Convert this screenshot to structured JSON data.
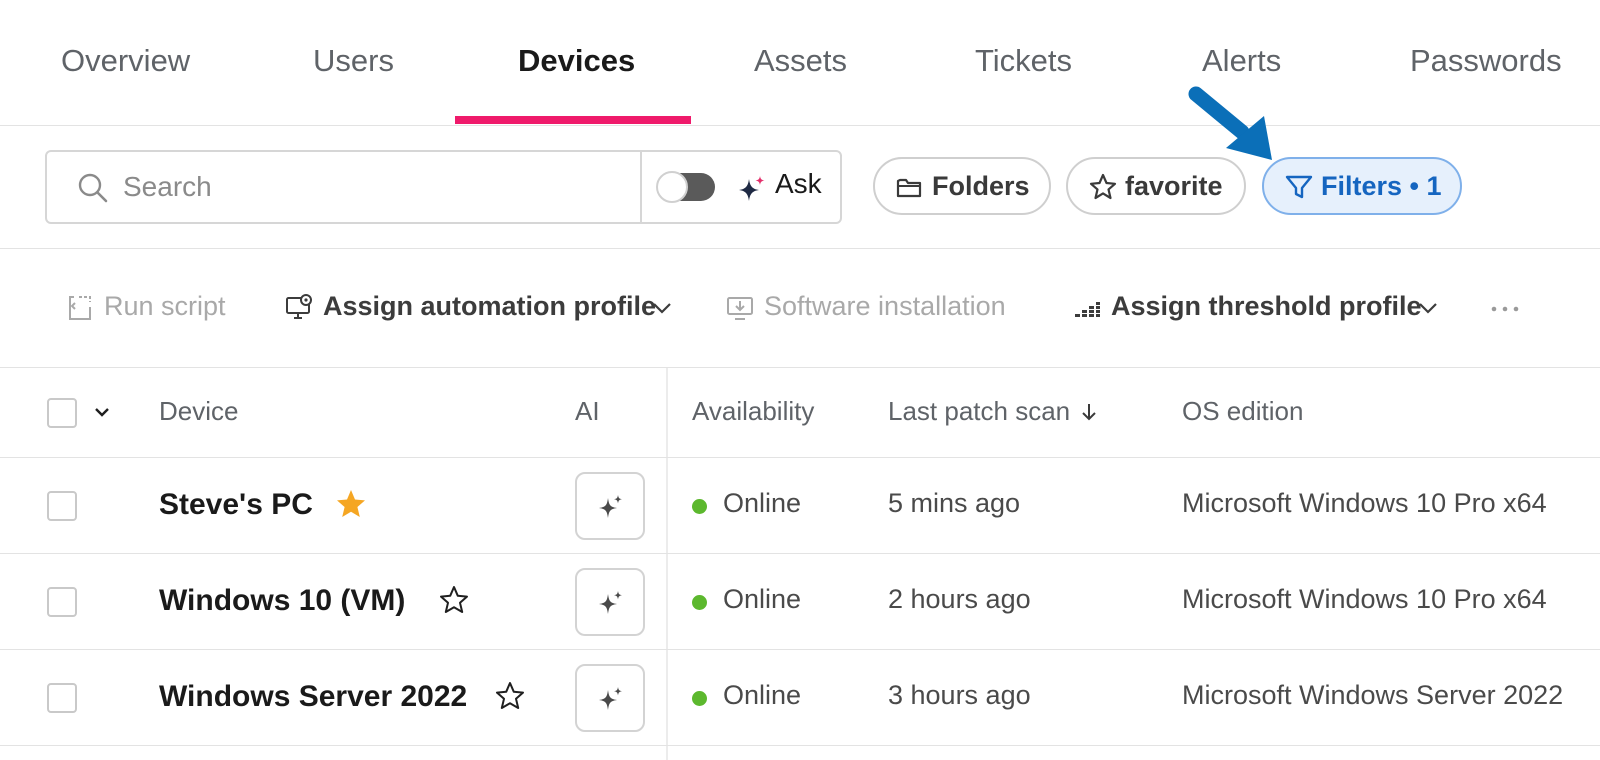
{
  "tabs": [
    {
      "label": "Overview"
    },
    {
      "label": "Users"
    },
    {
      "label": "Devices",
      "active": true
    },
    {
      "label": "Assets"
    },
    {
      "label": "Tickets"
    },
    {
      "label": "Alerts"
    },
    {
      "label": "Passwords"
    }
  ],
  "search": {
    "placeholder": "Search",
    "value": "",
    "ask_label": "Ask",
    "toggle_on": false
  },
  "pills": {
    "folders": "Folders",
    "favorite": "favorite",
    "filters": "Filters • 1"
  },
  "actions": {
    "run_script": "Run script",
    "assign_automation_profile": "Assign automation profile",
    "software_installation": "Software installation",
    "assign_threshold_profile": "Assign threshold profile"
  },
  "table": {
    "headers": {
      "device": "Device",
      "ai": "AI",
      "availability": "Availability",
      "last_patch_scan": "Last patch scan",
      "os_edition": "OS edition"
    },
    "rows": [
      {
        "device": "Steve's PC",
        "favorite": true,
        "availability": "Online",
        "last_patch_scan": "5 mins ago",
        "os_edition": "Microsoft Windows 10 Pro x64"
      },
      {
        "device": "Windows 10 (VM)",
        "favorite": false,
        "availability": "Online",
        "last_patch_scan": "2 hours ago",
        "os_edition": "Microsoft Windows 10 Pro x64"
      },
      {
        "device": "Windows Server 2022",
        "favorite": false,
        "availability": "Online",
        "last_patch_scan": "3 hours ago",
        "os_edition": "Microsoft Windows Server 2022"
      }
    ]
  },
  "colors": {
    "accent": "#ef1a6b",
    "filter_blue": "#1565c0",
    "online_green": "#5cb82e",
    "favorite_star": "#f5a623",
    "callout_arrow": "#0b6fb8"
  }
}
